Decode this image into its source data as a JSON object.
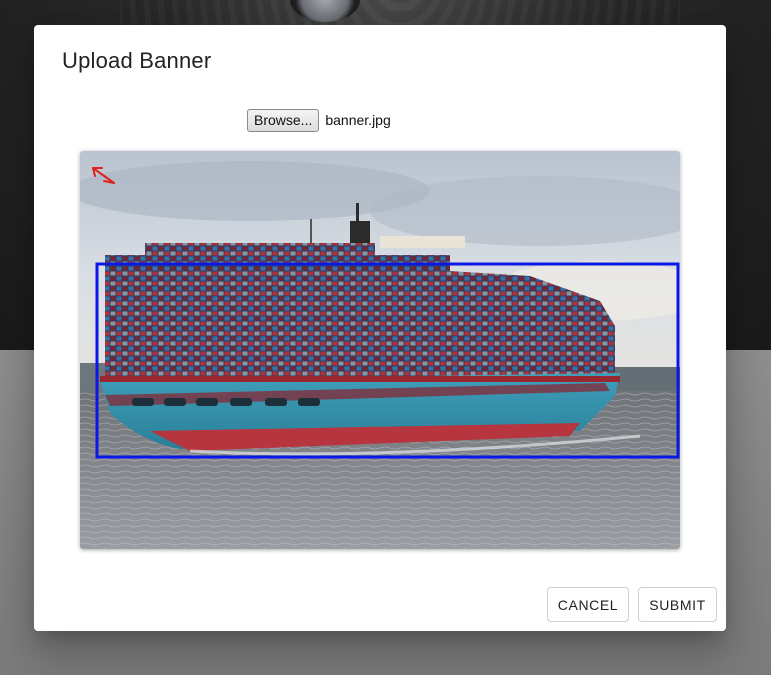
{
  "dialog": {
    "title": "Upload Banner",
    "file_input": {
      "browse_label": "Browse...",
      "file_name": "banner.jpg"
    },
    "preview": {
      "image_subject": "container ship at sea",
      "selection_color": "#0a18e6",
      "arrow_color": "#e02020"
    },
    "actions": {
      "cancel_label": "CANCEL",
      "submit_label": "SUBMIT"
    }
  },
  "backdrop": {
    "image_subject": "eagle"
  }
}
